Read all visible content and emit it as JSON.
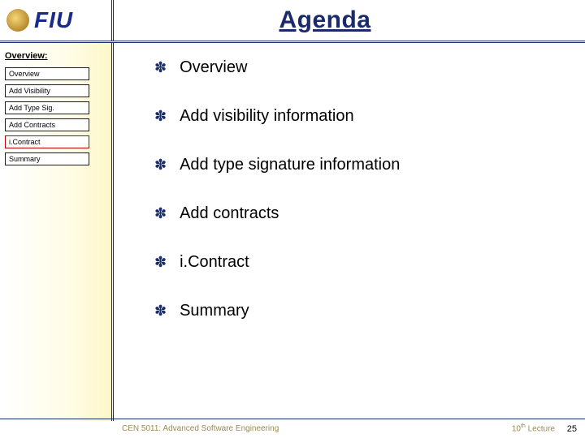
{
  "header": {
    "logo_text": "FIU",
    "title": "Agenda"
  },
  "sidebar": {
    "title": "Overview:",
    "items": [
      {
        "label": "Overview",
        "active": false
      },
      {
        "label": "Add Visibility",
        "active": false
      },
      {
        "label": "Add Type Sig.",
        "active": false
      },
      {
        "label": "Add Contracts",
        "active": false
      },
      {
        "label": "i.Contract",
        "active": true
      },
      {
        "label": "Summary",
        "active": false
      }
    ]
  },
  "content": {
    "items": [
      "Overview",
      "Add visibility information",
      "Add type signature information",
      "Add contracts",
      "i.Contract",
      "Summary"
    ]
  },
  "footer": {
    "course": "CEN 5011: Advanced Software Engineering",
    "lecture_ord": "10",
    "lecture_sup": "th",
    "lecture_word": " Lecture",
    "page": "25"
  }
}
